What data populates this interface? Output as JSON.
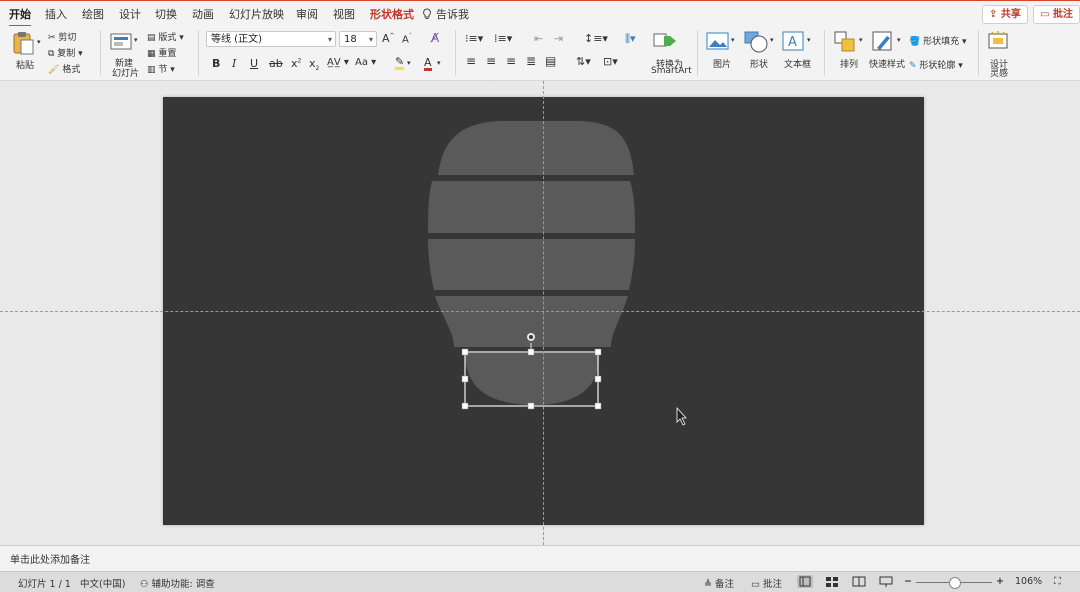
{
  "tabs": [
    {
      "label": "开始",
      "active": true
    },
    {
      "label": "插入"
    },
    {
      "label": "绘图"
    },
    {
      "label": "设计"
    },
    {
      "label": "切换"
    },
    {
      "label": "动画"
    },
    {
      "label": "幻灯片放映"
    },
    {
      "label": "审阅"
    },
    {
      "label": "视图"
    },
    {
      "label": "形状格式",
      "accent": true
    },
    {
      "label": "告诉我"
    }
  ],
  "share_label": "共享",
  "comment_label": "批注",
  "clipboard": {
    "paste": "粘贴",
    "cut": "剪切",
    "copy": "复制",
    "format": "格式"
  },
  "slides": {
    "new_slide_line1": "新建",
    "new_slide_line2": "幻灯片",
    "layout": "版式",
    "reset": "重置",
    "section": "节"
  },
  "font": {
    "name": "等线 (正文)",
    "size": "18"
  },
  "smartart": {
    "line1": "转换为",
    "line2": "SmartArt"
  },
  "insert": {
    "picture": "图片",
    "shape": "形状",
    "textbox": "文本框"
  },
  "arrange": {
    "arrange": "排列",
    "quick_styles": "快速样式",
    "fill": "形状填充",
    "outline": "形状轮廓"
  },
  "design": {
    "line1": "设计",
    "line2": "灵感"
  },
  "notes_placeholder": "单击此处添加备注",
  "status": {
    "slide_count": "幻灯片 1 / 1",
    "language": "中文(中国)",
    "accessibility": "辅助功能: 调查",
    "notes": "备注",
    "comments": "批注",
    "zoom": "106%"
  },
  "colors": {
    "accent": "#d24726",
    "slide_bg": "#363636",
    "shape_fill": "#5a5a5a"
  }
}
